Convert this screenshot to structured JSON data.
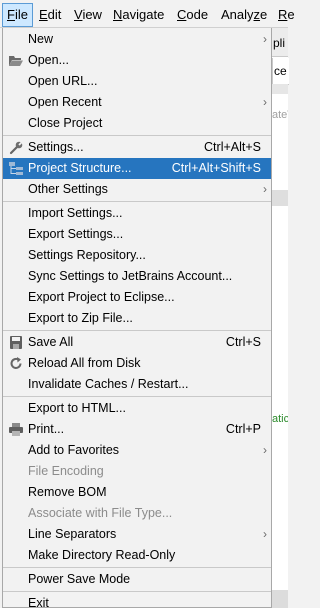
{
  "menubar": {
    "file": "File",
    "edit": "Edit",
    "view": "View",
    "navigate": "Navigate",
    "code": "Code",
    "analyze": "Analyze",
    "refactor_partial": "Re"
  },
  "background": {
    "tab_top": "pli",
    "tab_main": "ce",
    "faint_text": "ateV",
    "green_text": "atic"
  },
  "menu": {
    "new": {
      "label": "New"
    },
    "open": {
      "label": "Open..."
    },
    "open_url": {
      "label": "Open URL..."
    },
    "open_recent": {
      "label": "Open Recent"
    },
    "close_project": {
      "label": "Close Project"
    },
    "settings": {
      "label": "Settings...",
      "shortcut": "Ctrl+Alt+S"
    },
    "project_structure": {
      "label": "Project Structure...",
      "shortcut": "Ctrl+Alt+Shift+S"
    },
    "other_settings": {
      "label": "Other Settings"
    },
    "import_settings": {
      "label": "Import Settings..."
    },
    "export_settings": {
      "label": "Export Settings..."
    },
    "settings_repository": {
      "label": "Settings Repository..."
    },
    "sync_settings": {
      "label": "Sync Settings to JetBrains Account..."
    },
    "export_eclipse": {
      "label": "Export Project to Eclipse..."
    },
    "export_zip": {
      "label": "Export to Zip File..."
    },
    "save_all": {
      "label": "Save All",
      "shortcut": "Ctrl+S"
    },
    "reload_disk": {
      "label": "Reload All from Disk"
    },
    "invalidate_caches": {
      "label": "Invalidate Caches / Restart..."
    },
    "export_html": {
      "label": "Export to HTML..."
    },
    "print": {
      "label": "Print...",
      "shortcut": "Ctrl+P"
    },
    "add_favorites": {
      "label": "Add to Favorites"
    },
    "file_encoding": {
      "label": "File Encoding"
    },
    "remove_bom": {
      "label": "Remove BOM"
    },
    "associate_file_type": {
      "label": "Associate with File Type..."
    },
    "line_separators": {
      "label": "Line Separators"
    },
    "make_read_only": {
      "label": "Make Directory Read-Only"
    },
    "power_save": {
      "label": "Power Save Mode"
    },
    "exit": {
      "label": "Exit"
    }
  },
  "colors": {
    "highlight": "#2675bf",
    "menubar_active": "#cde8ff",
    "disabled_text": "#8c8c8c"
  },
  "icons": {
    "open": "folder-open-icon",
    "settings": "wrench-icon",
    "project_structure": "project-structure-icon",
    "save_all": "floppy-disk-icon",
    "reload_disk": "reload-icon",
    "print": "printer-icon"
  }
}
